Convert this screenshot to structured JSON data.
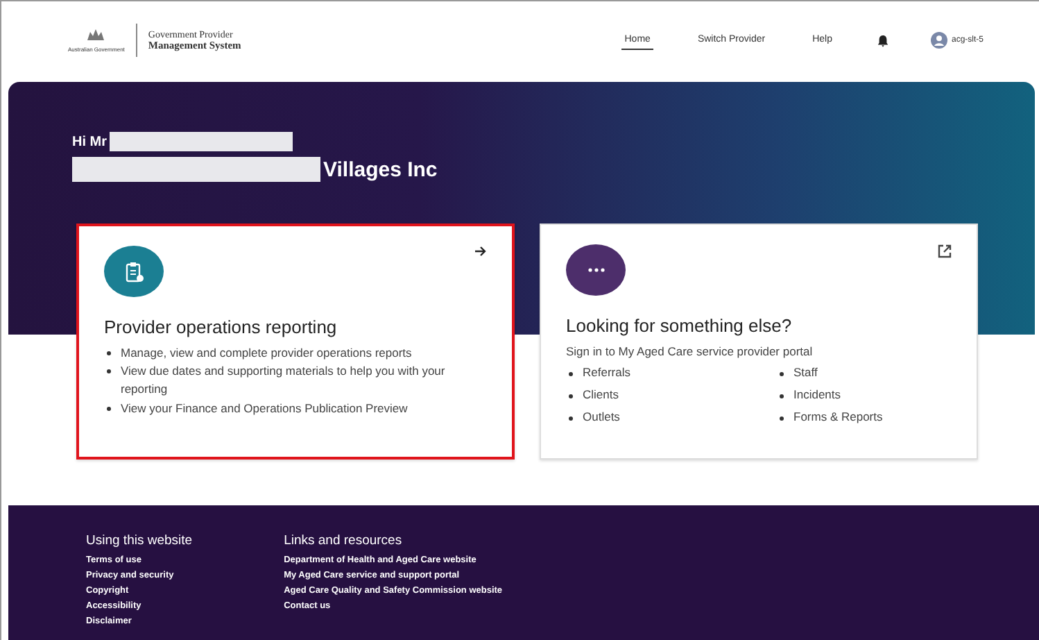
{
  "header": {
    "logo_text": "Australian Government",
    "system_name_top": "Government Provider",
    "system_name_bottom": "Management System",
    "nav": [
      {
        "label": "Home",
        "selected": true
      },
      {
        "label": "Switch Provider",
        "selected": false
      },
      {
        "label": "Help",
        "selected": false
      }
    ],
    "user": "acg-slt-5"
  },
  "hero": {
    "greeting": "Hi Mr",
    "organisation": "Villages Inc"
  },
  "cards": [
    {
      "kind": "internal",
      "title": "Provider operations reporting",
      "highlighted": true,
      "color": "#1b7f93",
      "items": [
        "Manage, view and complete provider operations reports",
        "View due dates and supporting materials to help you with your reporting",
        "View your Finance and Operations Publication Preview"
      ]
    },
    {
      "kind": "external",
      "title": "Looking for something else?",
      "highlighted": false,
      "color": "#4d2e6b",
      "subtitle": "Sign in to My Aged Care service provider portal",
      "items": [
        "Referrals",
        "Staff",
        "Clients",
        "Incidents",
        "Outlets",
        "Forms & Reports"
      ]
    }
  ],
  "footer": {
    "columns": [
      {
        "heading": "Using this website",
        "links": [
          "Terms of use",
          "Privacy and security",
          "Copyright",
          "Accessibility",
          "Disclaimer"
        ]
      },
      {
        "heading": "Links and resources",
        "links": [
          "Department of Health and Aged Care website",
          "My Aged Care service and support portal",
          "Aged Care Quality and Safety Commission website",
          "Contact us"
        ]
      }
    ]
  }
}
